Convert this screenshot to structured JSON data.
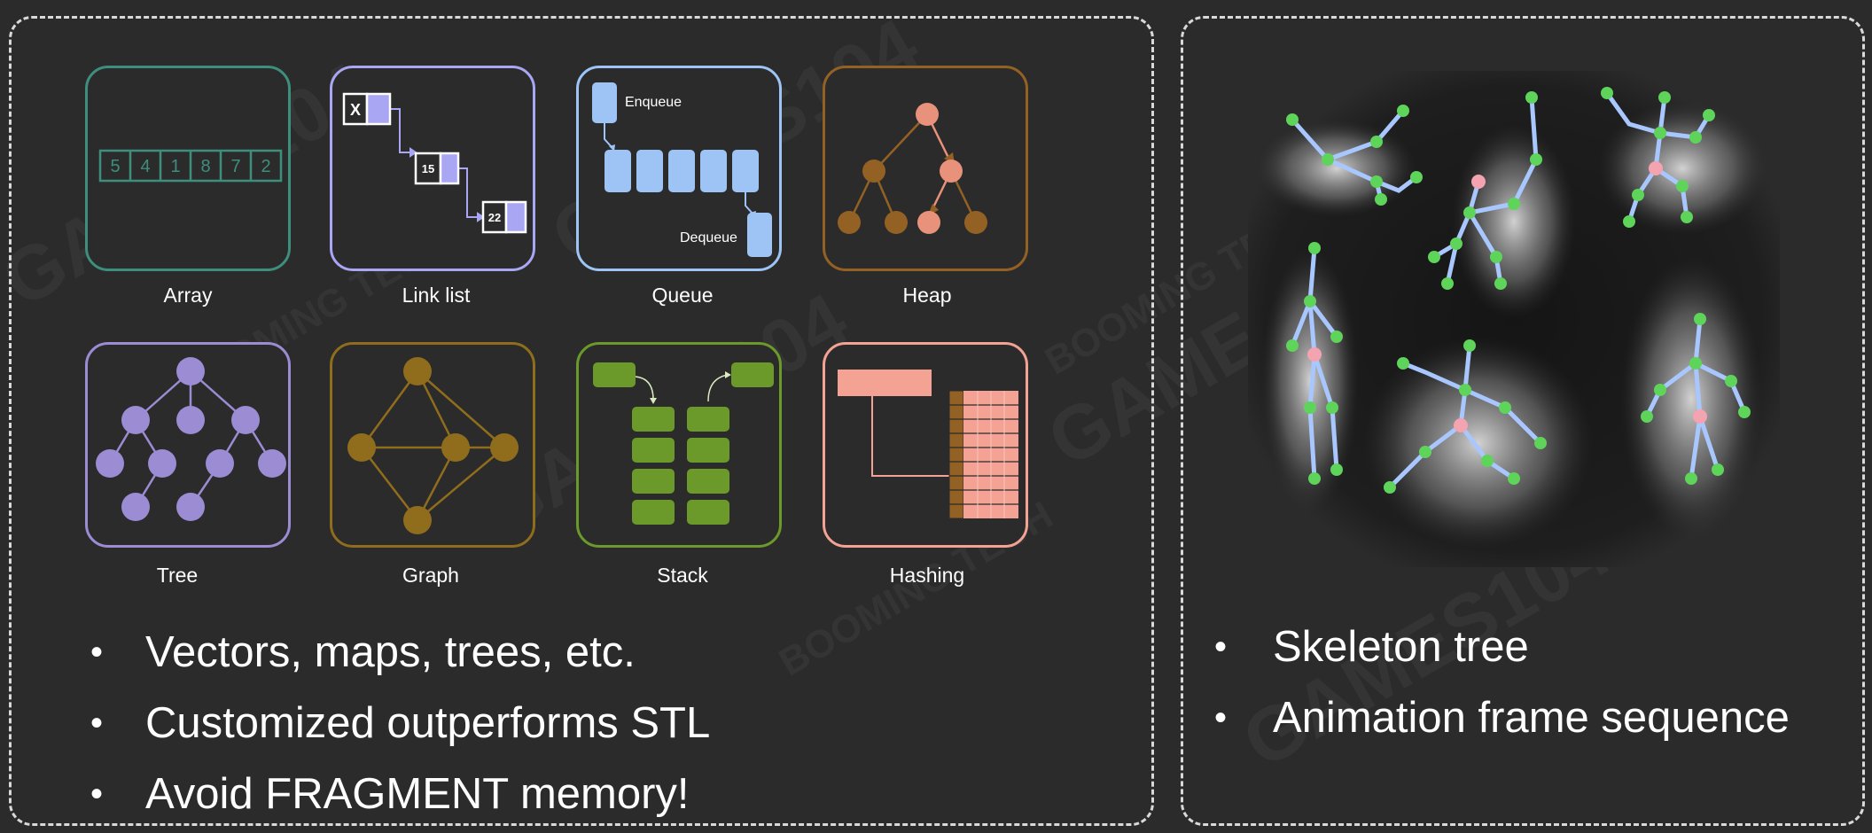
{
  "left_panel": {
    "cards": [
      {
        "id": "array",
        "label": "Array",
        "color": "#3e8e7e"
      },
      {
        "id": "linklist",
        "label": "Link list",
        "color": "#a9a6f3"
      },
      {
        "id": "queue",
        "label": "Queue",
        "color": "#9ec4f5"
      },
      {
        "id": "heap",
        "label": "Heap",
        "color": "#946124"
      },
      {
        "id": "tree",
        "label": "Tree",
        "color": "#9b8cd3"
      },
      {
        "id": "graph",
        "label": "Graph",
        "color": "#8f6d1c"
      },
      {
        "id": "stack",
        "label": "Stack",
        "color": "#6b9a2a"
      },
      {
        "id": "hashing",
        "label": "Hashing",
        "color": "#f3a293"
      }
    ],
    "array_values": [
      "5",
      "4",
      "1",
      "8",
      "7",
      "2"
    ],
    "linklist_values": [
      "X",
      "15",
      "22"
    ],
    "queue_labels": {
      "enqueue": "Enqueue",
      "dequeue": "Dequeue"
    },
    "bullets": [
      "Vectors, maps, trees, etc.",
      "Customized outperforms STL",
      "Avoid FRAGMENT memory!"
    ]
  },
  "right_panel": {
    "bullets": [
      "Skeleton tree",
      "Animation frame sequence"
    ]
  },
  "bullet_symbol": "•",
  "watermarks": [
    "GAMES104",
    "BOOMING TECH"
  ]
}
